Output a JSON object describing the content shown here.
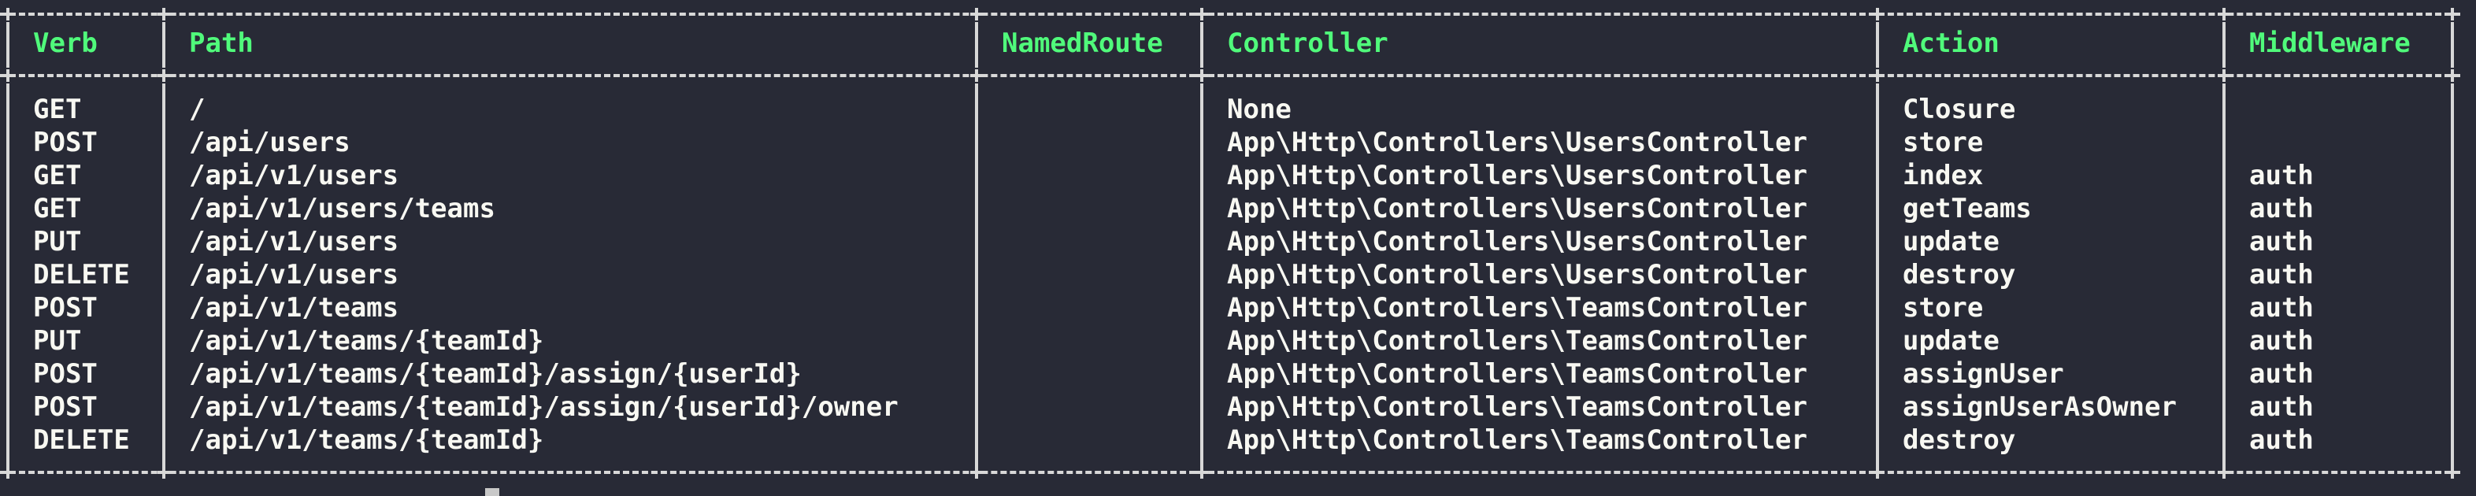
{
  "table": {
    "headers": [
      "Verb",
      "Path",
      "NamedRoute",
      "Controller",
      "Action",
      "Middleware"
    ],
    "rows": [
      [
        "GET",
        "/",
        "",
        "None",
        "Closure",
        ""
      ],
      [
        "POST",
        "/api/users",
        "",
        "App\\Http\\Controllers\\UsersController",
        "store",
        ""
      ],
      [
        "GET",
        "/api/v1/users",
        "",
        "App\\Http\\Controllers\\UsersController",
        "index",
        "auth"
      ],
      [
        "GET",
        "/api/v1/users/teams",
        "",
        "App\\Http\\Controllers\\UsersController",
        "getTeams",
        "auth"
      ],
      [
        "PUT",
        "/api/v1/users",
        "",
        "App\\Http\\Controllers\\UsersController",
        "update",
        "auth"
      ],
      [
        "DELETE",
        "/api/v1/users",
        "",
        "App\\Http\\Controllers\\UsersController",
        "destroy",
        "auth"
      ],
      [
        "POST",
        "/api/v1/teams",
        "",
        "App\\Http\\Controllers\\TeamsController",
        "store",
        "auth"
      ],
      [
        "PUT",
        "/api/v1/teams/{teamId}",
        "",
        "App\\Http\\Controllers\\TeamsController",
        "update",
        "auth"
      ],
      [
        "POST",
        "/api/v1/teams/{teamId}/assign/{userId}",
        "",
        "App\\Http\\Controllers\\TeamsController",
        "assignUser",
        "auth"
      ],
      [
        "POST",
        "/api/v1/teams/{teamId}/assign/{userId}/owner",
        "",
        "App\\Http\\Controllers\\TeamsController",
        "assignUserAsOwner",
        "auth"
      ],
      [
        "DELETE",
        "/api/v1/teams/{teamId}",
        "",
        "App\\Http\\Controllers\\TeamsController",
        "destroy",
        "auth"
      ]
    ]
  },
  "colors": {
    "background": "#282a36",
    "header_text": "#50fa7b",
    "body_text": "#f8f8f2",
    "border": "#d8d8d8"
  }
}
